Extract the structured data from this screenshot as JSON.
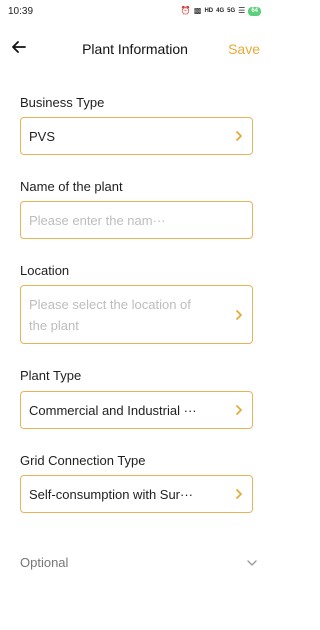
{
  "status_bar": {
    "time": "10:39",
    "icons": [
      "alarm-icon",
      "nfc-icon",
      "hd-icon",
      "signal-4g-icon",
      "signal-5g-icon",
      "wifi-icon",
      "battery-icon"
    ],
    "hd_text": "HD",
    "net_4g": "4G",
    "net_5g": "5G",
    "battery": "64"
  },
  "header": {
    "title": "Plant Information",
    "save_label": "Save"
  },
  "form": {
    "business_type": {
      "label": "Business Type",
      "value": "PVS"
    },
    "plant_name": {
      "label": "Name of the plant",
      "placeholder": "Please enter the nam···"
    },
    "location": {
      "label": "Location",
      "placeholder_line1": "Please select the location of",
      "placeholder_line2": "the plant"
    },
    "plant_type": {
      "label": "Plant Type",
      "value": "Commercial and Industrial ···"
    },
    "grid_connection": {
      "label": "Grid Connection Type",
      "value": "Self-consumption with Sur···"
    },
    "optional_label": "Optional"
  },
  "colors": {
    "accent": "#e8a93b",
    "border": "#e8b45a",
    "placeholder": "#bdbdbd"
  }
}
